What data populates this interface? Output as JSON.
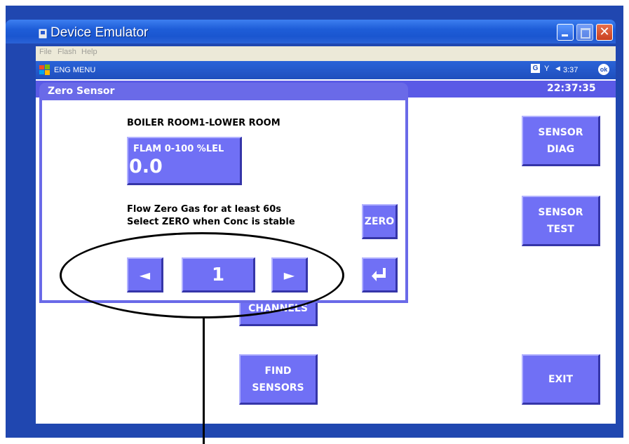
{
  "window": {
    "title": "Device Emulator",
    "controls": {
      "close": "✕"
    }
  },
  "menubar": {
    "items": [
      "File",
      "Flash",
      "Help"
    ]
  },
  "wm_bar": {
    "title": "ENG MENU",
    "tray": {
      "g_icon": "G",
      "time": "3:37",
      "ok": "ok"
    }
  },
  "screen": {
    "clock": "22:37:35"
  },
  "buttons": {
    "sensor_diag": "SENSOR\nDIAG",
    "sensor_test": "SENSOR\nTEST",
    "channels": "CHANNELS",
    "find_sensors": "FIND\nSENSORS",
    "exit": "EXIT"
  },
  "dialog": {
    "title": "Zero Sensor",
    "location": "BOILER ROOM1-LOWER ROOM",
    "sensor": {
      "range": "FLAM 0-100 %LEL",
      "value": "0.0"
    },
    "instructions": [
      "Flow Zero Gas for at least 60s",
      "Select ZERO when Conc is stable"
    ],
    "zero_button": "ZERO",
    "nav": {
      "prev": "◄",
      "channel": "1",
      "next": "►"
    },
    "enter_icon": "enter-icon"
  },
  "colors": {
    "frame": "#2047b0",
    "button": "#7070f5",
    "strip": "#5a5ae6"
  }
}
